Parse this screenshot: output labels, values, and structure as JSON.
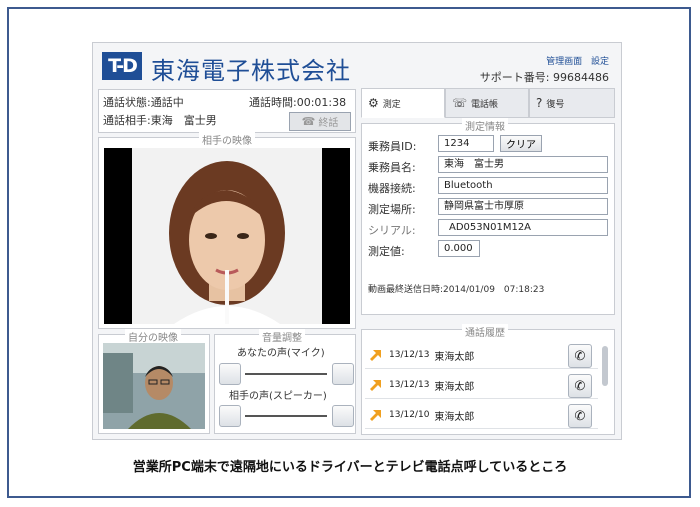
{
  "header": {
    "logo_mark": "T-D",
    "company_name": "東海電子株式会社",
    "links": [
      "管理画面",
      "設定"
    ],
    "support_label": "サポート番号:",
    "support_number": "99684486"
  },
  "call": {
    "status_label": "通話状態:",
    "status_value": "通話中",
    "time_label": "通話時間:",
    "time_value": "00:01:38",
    "partner_label": "通話相手:",
    "partner_value": "東海　富士男",
    "end_button": "終話"
  },
  "partner_video": {
    "title": "相手の映像"
  },
  "self_video": {
    "title": "自分の映像"
  },
  "volume": {
    "title": "音量調整",
    "mic_label": "あなたの声(マイク)",
    "speaker_label": "相手の声(スピーカー)"
  },
  "tabs": [
    {
      "label": "測定",
      "icon": "measure-icon"
    },
    {
      "label": "電話帳",
      "icon": "phonebook-icon"
    },
    {
      "label": "復号",
      "icon": "decode-icon"
    }
  ],
  "measure": {
    "title": "測定情報",
    "crew_id_label": "乗務員ID:",
    "crew_id_value": "1234",
    "clear_button": "クリア",
    "crew_name_label": "乗務員名:",
    "crew_name_value": "東海　富士男",
    "device_label": "機器接続:",
    "device_value": "Bluetooth",
    "place_label": "測定場所:",
    "place_value": "静岡県富士市厚原",
    "serial_label": "シリアル:",
    "serial_value": "AD053N01M12A",
    "value_label": "測定値:",
    "value_value": "0.000",
    "last_sent_label": "動画最終送信日時:",
    "last_sent_value": "2014/01/09　07:18:23"
  },
  "history": {
    "title": "通話履歴",
    "rows": [
      {
        "date": "13/12/13",
        "name": "東海太郎"
      },
      {
        "date": "13/12/13",
        "name": "東海太郎"
      },
      {
        "date": "13/12/10",
        "name": "東海太郎"
      }
    ]
  },
  "caption": "営業所PC端末で遠隔地にいるドライバーとテレビ電話点呼しているところ",
  "colors": {
    "brand": "#1f4e96",
    "border": "#3d5a8f",
    "arrow": "#f0a020"
  }
}
